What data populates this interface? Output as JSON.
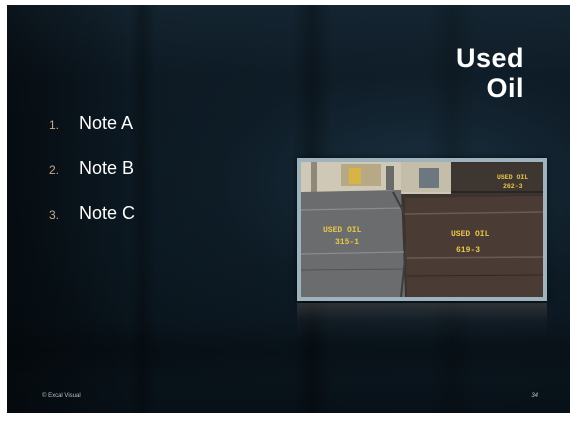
{
  "slide": {
    "title_line1": "Used",
    "title_line2": "Oil",
    "notes": [
      {
        "number": "1.",
        "text": "Note A"
      },
      {
        "number": "2.",
        "text": "Note B"
      },
      {
        "number": "3.",
        "text": "Note C"
      }
    ],
    "photo": {
      "drums": [
        {
          "label": "USED OIL",
          "code": "262-3"
        },
        {
          "label": "USED OIL",
          "code": "315-1"
        },
        {
          "label": "USED OIL",
          "code": "619-3"
        }
      ]
    },
    "footer_left": "© Excal Visual",
    "page_number": "34"
  },
  "colors": {
    "background": "#0b1720",
    "title": "#ffffff",
    "note_text": "#ffffff",
    "note_number": "#c9a98a",
    "photo_frame": "#9fb3bf",
    "stencil_yellow": "#e8c64a"
  }
}
